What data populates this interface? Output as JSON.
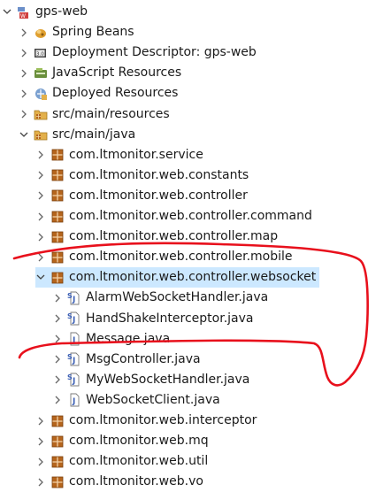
{
  "tree": [
    {
      "label": "gps-web",
      "icon": "web-project-icon",
      "expanded": true,
      "level": 0
    },
    {
      "label": "Spring Beans",
      "icon": "spring-beans-icon",
      "expanded": false,
      "level": 1
    },
    {
      "label": "Deployment Descriptor: gps-web",
      "icon": "deployment-descriptor-icon",
      "expanded": false,
      "level": 1
    },
    {
      "label": "JavaScript Resources",
      "icon": "javascript-resources-icon",
      "expanded": false,
      "level": 1
    },
    {
      "label": "Deployed Resources",
      "icon": "deployed-resources-icon",
      "expanded": false,
      "level": 1
    },
    {
      "label": "src/main/resources",
      "icon": "source-folder-icon",
      "expanded": false,
      "level": 1
    },
    {
      "label": "src/main/java",
      "icon": "source-folder-icon",
      "expanded": true,
      "level": 1
    },
    {
      "label": "com.ltmonitor.service",
      "icon": "package-icon",
      "expanded": false,
      "level": 2
    },
    {
      "label": "com.ltmonitor.web.constants",
      "icon": "package-icon",
      "expanded": false,
      "level": 2
    },
    {
      "label": "com.ltmonitor.web.controller",
      "icon": "package-icon",
      "expanded": false,
      "level": 2
    },
    {
      "label": "com.ltmonitor.web.controller.command",
      "icon": "package-icon",
      "expanded": false,
      "level": 2
    },
    {
      "label": "com.ltmonitor.web.controller.map",
      "icon": "package-icon",
      "expanded": false,
      "level": 2
    },
    {
      "label": "com.ltmonitor.web.controller.mobile",
      "icon": "package-icon",
      "expanded": false,
      "level": 2
    },
    {
      "label": "com.ltmonitor.web.controller.websocket",
      "icon": "package-icon",
      "expanded": true,
      "level": 2,
      "selected": true
    },
    {
      "label": "AlarmWebSocketHandler.java",
      "icon": "java-source-file-icon",
      "expanded": false,
      "level": 3
    },
    {
      "label": "HandShakeInterceptor.java",
      "icon": "java-source-file-icon",
      "expanded": false,
      "level": 3
    },
    {
      "label": "Message.java",
      "icon": "java-file-icon",
      "expanded": false,
      "level": 3
    },
    {
      "label": "MsgController.java",
      "icon": "java-source-file-icon",
      "expanded": false,
      "level": 3
    },
    {
      "label": "MyWebSocketHandler.java",
      "icon": "java-source-file-icon",
      "expanded": false,
      "level": 3
    },
    {
      "label": "WebSocketClient.java",
      "icon": "java-file-icon",
      "expanded": false,
      "level": 3
    },
    {
      "label": "com.ltmonitor.web.interceptor",
      "icon": "package-icon",
      "expanded": false,
      "level": 2
    },
    {
      "label": "com.ltmonitor.web.mq",
      "icon": "package-icon",
      "expanded": false,
      "level": 2
    },
    {
      "label": "com.ltmonitor.web.util",
      "icon": "package-icon",
      "expanded": false,
      "level": 2
    },
    {
      "label": "com.ltmonitor.web.vo",
      "icon": "package-icon",
      "expanded": false,
      "level": 2
    }
  ],
  "colors": {
    "selection": "#cce8ff",
    "annotation": "#e8101c",
    "package": "#b5651d",
    "java": "#3b5fb5"
  }
}
